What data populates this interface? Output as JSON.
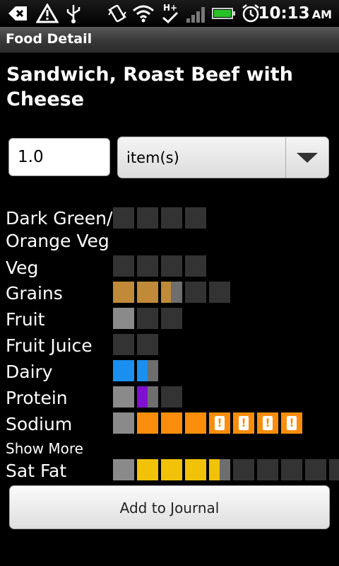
{
  "status_bar": {
    "time": "10:13",
    "ampm": "AM",
    "network": "H+",
    "icons": [
      "usb-debug-icon",
      "warning-icon",
      "usb-icon",
      "vibrate-icon",
      "wifi-icon",
      "hplus-icon",
      "signal-icon",
      "battery-icon",
      "alarm-icon"
    ]
  },
  "title_bar": {
    "title": "Food Detail"
  },
  "food": {
    "name": "Sandwich, Roast Beef with Cheese"
  },
  "quantity": {
    "value": "1.0"
  },
  "unit": {
    "selected": "item(s)"
  },
  "nutrients": [
    {
      "label": "Dark Green/ Orange Veg",
      "label_line1": "Dark Green/",
      "label_line2": "Orange Veg",
      "filled": 0,
      "total": 4
    },
    {
      "label": "Veg",
      "filled": 0,
      "total": 4
    },
    {
      "label": "Grains",
      "filled": 2.4,
      "total": 5,
      "color": "#c08a38"
    },
    {
      "label": "Fruit",
      "filled": 0,
      "total": 3
    },
    {
      "label": "Fruit Juice",
      "filled": 0,
      "total": 2
    },
    {
      "label": "Dairy",
      "filled": 1.5,
      "total": 2,
      "color": "#1a8ff0"
    },
    {
      "label": "Protein",
      "filled": 1.5,
      "total": 3,
      "color": "#8010d0"
    },
    {
      "label": "Sodium",
      "filled": 8,
      "total": 8,
      "color": "#fb8d0c",
      "warnings": 4
    },
    {
      "label": "Sat Fat",
      "filled": 4.5,
      "total": 9,
      "color": "#f2c208"
    }
  ],
  "show_more_label": "Show More",
  "add_button_label": "Add to Journal",
  "colors": {
    "empty": "#333333",
    "consumed": "#8a8a8a",
    "grains": "#c08a38",
    "dairy": "#1a8ff0",
    "protein": "#8010d0",
    "sodium": "#fb8d0c",
    "sat_fat": "#f2c208"
  }
}
